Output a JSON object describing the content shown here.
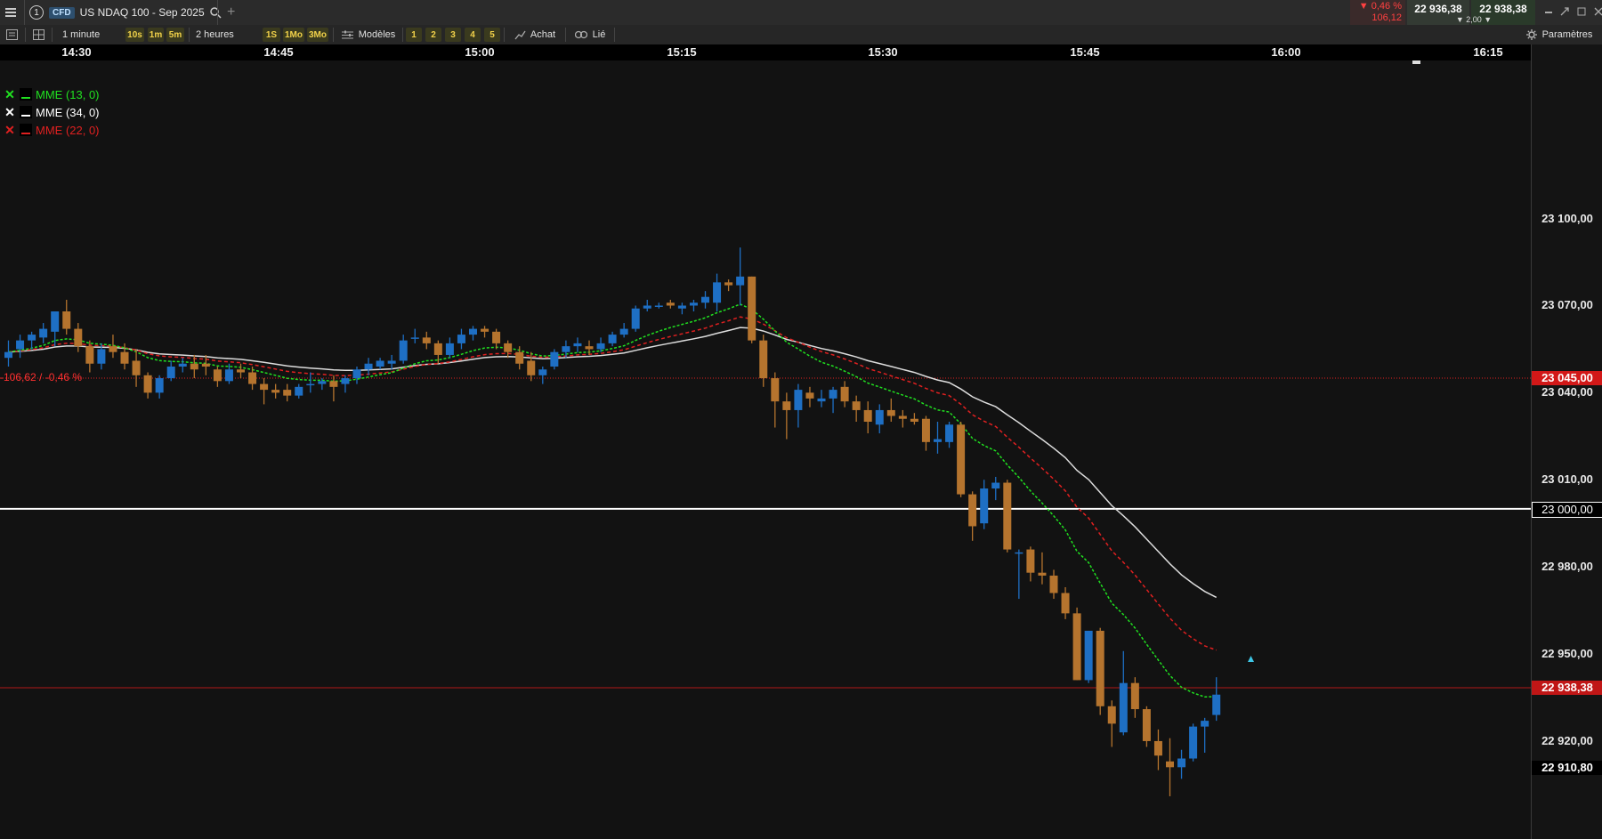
{
  "topbar": {
    "info_label": "1",
    "cfd_badge": "CFD",
    "instrument": "US NDAQ 100 - Sep 2025",
    "add_tab": "+",
    "change_pct": "▼ 0,46 %",
    "change_pts": "106,12",
    "bid": "22 936,38",
    "ask": "22 938,38",
    "spread": "▼ 2,00 ▼"
  },
  "toolbar": {
    "interval": "1 minute",
    "tf_10s": "10s",
    "tf_1m": "1m",
    "tf_5m": "5m",
    "range": "2 heures",
    "range_1s": "1S",
    "range_1mo": "1Mo",
    "range_3mo": "3Mo",
    "templates": "Modèles",
    "layout_1": "1",
    "layout_2": "2",
    "layout_3": "3",
    "layout_4": "4",
    "layout_5": "5",
    "buy": "Achat",
    "linked": "Lié",
    "settings": "Paramètres"
  },
  "time_axis": [
    "14:30",
    "14:45",
    "15:00",
    "15:15",
    "15:30",
    "15:45",
    "16:00",
    "16:15"
  ],
  "legend": [
    {
      "label": "MME (13, 0)",
      "color": "#20e020"
    },
    {
      "label": "MME (34, 0)",
      "color": "#ffffff"
    },
    {
      "label": "MME (22, 0)",
      "color": "#e02020"
    }
  ],
  "prev_close_label": "-106,62 / -0,46 %",
  "price_axis": {
    "ticks": [
      "23 100,00",
      "23 070,00",
      "23 040,00",
      "23 010,00",
      "22 980,00",
      "22 950,00",
      "22 920,00"
    ],
    "prev_close_tag": "23 045,00",
    "level_tag": "23 000,00",
    "current_tag": "22 938,38",
    "low_tag": "22 910,80"
  },
  "colors": {
    "up": "#1e6fc4",
    "down": "#b5742e",
    "ema13": "#20e020",
    "ema34": "#dddddd",
    "ema22": "#e02020",
    "prev_close": "#e02020",
    "level": "#ffffff"
  },
  "chart_data": {
    "type": "candlestick",
    "interval": "1 minute",
    "ylim": [
      22897,
      23125
    ],
    "prev_close": 23045,
    "horizontal_level": 23000,
    "last_price": 22938.38,
    "candles": [
      {
        "o": 23052,
        "h": 23058,
        "l": 23049,
        "c": 23054
      },
      {
        "o": 23055,
        "h": 23060,
        "l": 23052,
        "c": 23058
      },
      {
        "o": 23058,
        "h": 23061,
        "l": 23055,
        "c": 23060
      },
      {
        "o": 23059,
        "h": 23064,
        "l": 23057,
        "c": 23062
      },
      {
        "o": 23061,
        "h": 23066,
        "l": 23056,
        "c": 23068
      },
      {
        "o": 23068,
        "h": 23072,
        "l": 23060,
        "c": 23062
      },
      {
        "o": 23062,
        "h": 23064,
        "l": 23054,
        "c": 23056
      },
      {
        "o": 23056,
        "h": 23058,
        "l": 23047,
        "c": 23050
      },
      {
        "o": 23050,
        "h": 23057,
        "l": 23048,
        "c": 23055
      },
      {
        "o": 23056,
        "h": 23060,
        "l": 23052,
        "c": 23054
      },
      {
        "o": 23054,
        "h": 23057,
        "l": 23048,
        "c": 23050
      },
      {
        "o": 23051,
        "h": 23055,
        "l": 23042,
        "c": 23046
      },
      {
        "o": 23046,
        "h": 23047,
        "l": 23038,
        "c": 23040
      },
      {
        "o": 23040,
        "h": 23046,
        "l": 23038,
        "c": 23045
      },
      {
        "o": 23045,
        "h": 23051,
        "l": 23044,
        "c": 23049
      },
      {
        "o": 23049,
        "h": 23052,
        "l": 23047,
        "c": 23050
      },
      {
        "o": 23050,
        "h": 23053,
        "l": 23045,
        "c": 23048
      },
      {
        "o": 23050,
        "h": 23053,
        "l": 23046,
        "c": 23049
      },
      {
        "o": 23048,
        "h": 23049,
        "l": 23042,
        "c": 23044
      },
      {
        "o": 23044,
        "h": 23050,
        "l": 23043,
        "c": 23048
      },
      {
        "o": 23048,
        "h": 23050,
        "l": 23045,
        "c": 23047
      },
      {
        "o": 23047,
        "h": 23049,
        "l": 23041,
        "c": 23043
      },
      {
        "o": 23043,
        "h": 23045,
        "l": 23036,
        "c": 23041
      },
      {
        "o": 23041,
        "h": 23043,
        "l": 23038,
        "c": 23040
      },
      {
        "o": 23041,
        "h": 23043,
        "l": 23037,
        "c": 23039
      },
      {
        "o": 23039,
        "h": 23043,
        "l": 23038,
        "c": 23042
      },
      {
        "o": 23043,
        "h": 23047,
        "l": 23040,
        "c": 23043
      },
      {
        "o": 23043,
        "h": 23045,
        "l": 23041,
        "c": 23044
      },
      {
        "o": 23044,
        "h": 23046,
        "l": 23037,
        "c": 23042
      },
      {
        "o": 23043,
        "h": 23046,
        "l": 23040,
        "c": 23045
      },
      {
        "o": 23045,
        "h": 23049,
        "l": 23043,
        "c": 23048
      },
      {
        "o": 23048,
        "h": 23052,
        "l": 23046,
        "c": 23050
      },
      {
        "o": 23049,
        "h": 23052,
        "l": 23048,
        "c": 23051
      },
      {
        "o": 23050,
        "h": 23053,
        "l": 23048,
        "c": 23051
      },
      {
        "o": 23051,
        "h": 23060,
        "l": 23050,
        "c": 23058
      },
      {
        "o": 23059,
        "h": 23062,
        "l": 23057,
        "c": 23059
      },
      {
        "o": 23059,
        "h": 23061,
        "l": 23055,
        "c": 23057
      },
      {
        "o": 23057,
        "h": 23058,
        "l": 23050,
        "c": 23053
      },
      {
        "o": 23053,
        "h": 23059,
        "l": 23052,
        "c": 23057
      },
      {
        "o": 23057,
        "h": 23062,
        "l": 23055,
        "c": 23060
      },
      {
        "o": 23060,
        "h": 23063,
        "l": 23058,
        "c": 23062
      },
      {
        "o": 23062,
        "h": 23063,
        "l": 23059,
        "c": 23061
      },
      {
        "o": 23061,
        "h": 23062,
        "l": 23055,
        "c": 23057
      },
      {
        "o": 23057,
        "h": 23058,
        "l": 23052,
        "c": 23054
      },
      {
        "o": 23054,
        "h": 23056,
        "l": 23048,
        "c": 23050
      },
      {
        "o": 23051,
        "h": 23054,
        "l": 23044,
        "c": 23046
      },
      {
        "o": 23046,
        "h": 23049,
        "l": 23043,
        "c": 23048
      },
      {
        "o": 23049,
        "h": 23055,
        "l": 23048,
        "c": 23054
      },
      {
        "o": 23054,
        "h": 23058,
        "l": 23052,
        "c": 23056
      },
      {
        "o": 23056,
        "h": 23059,
        "l": 23054,
        "c": 23057
      },
      {
        "o": 23056,
        "h": 23058,
        "l": 23053,
        "c": 23055
      },
      {
        "o": 23055,
        "h": 23059,
        "l": 23054,
        "c": 23057
      },
      {
        "o": 23057,
        "h": 23061,
        "l": 23056,
        "c": 23060
      },
      {
        "o": 23060,
        "h": 23064,
        "l": 23059,
        "c": 23062
      },
      {
        "o": 23062,
        "h": 23070,
        "l": 23061,
        "c": 23069
      },
      {
        "o": 23069,
        "h": 23072,
        "l": 23068,
        "c": 23070
      },
      {
        "o": 23070,
        "h": 23071,
        "l": 23069,
        "c": 23070
      },
      {
        "o": 23071,
        "h": 23072,
        "l": 23069,
        "c": 23070
      },
      {
        "o": 23069,
        "h": 23071,
        "l": 23067,
        "c": 23070
      },
      {
        "o": 23070,
        "h": 23072,
        "l": 23068,
        "c": 23071
      },
      {
        "o": 23071,
        "h": 23075,
        "l": 23069,
        "c": 23073
      },
      {
        "o": 23071,
        "h": 23081,
        "l": 23068,
        "c": 23078
      },
      {
        "o": 23078,
        "h": 23079,
        "l": 23075,
        "c": 23077
      },
      {
        "o": 23077,
        "h": 23090,
        "l": 23070,
        "c": 23080
      },
      {
        "o": 23080,
        "h": 23080,
        "l": 23057,
        "c": 23058
      },
      {
        "o": 23058,
        "h": 23060,
        "l": 23042,
        "c": 23045
      },
      {
        "o": 23045,
        "h": 23047,
        "l": 23028,
        "c": 23037
      },
      {
        "o": 23037,
        "h": 23040,
        "l": 23024,
        "c": 23034
      },
      {
        "o": 23034,
        "h": 23043,
        "l": 23028,
        "c": 23041
      },
      {
        "o": 23040,
        "h": 23042,
        "l": 23035,
        "c": 23038
      },
      {
        "o": 23037,
        "h": 23041,
        "l": 23035,
        "c": 23038
      },
      {
        "o": 23038,
        "h": 23042,
        "l": 23033,
        "c": 23041
      },
      {
        "o": 23042,
        "h": 23044,
        "l": 23035,
        "c": 23037
      },
      {
        "o": 23037,
        "h": 23039,
        "l": 23030,
        "c": 23034
      },
      {
        "o": 23034,
        "h": 23037,
        "l": 23026,
        "c": 23030
      },
      {
        "o": 23029,
        "h": 23036,
        "l": 23026,
        "c": 23034
      },
      {
        "o": 23034,
        "h": 23038,
        "l": 23030,
        "c": 23032
      },
      {
        "o": 23032,
        "h": 23034,
        "l": 23028,
        "c": 23031
      },
      {
        "o": 23031,
        "h": 23033,
        "l": 23029,
        "c": 23030
      },
      {
        "o": 23031,
        "h": 23032,
        "l": 23020,
        "c": 23023
      },
      {
        "o": 23023,
        "h": 23030,
        "l": 23019,
        "c": 23024
      },
      {
        "o": 23023,
        "h": 23030,
        "l": 23021,
        "c": 23029
      },
      {
        "o": 23029,
        "h": 23030,
        "l": 23004,
        "c": 23005
      },
      {
        "o": 23005,
        "h": 23006,
        "l": 22989,
        "c": 22994
      },
      {
        "o": 22995,
        "h": 23010,
        "l": 22993,
        "c": 23007
      },
      {
        "o": 23007,
        "h": 23011,
        "l": 23003,
        "c": 23009
      },
      {
        "o": 23009,
        "h": 23010,
        "l": 22985,
        "c": 22986
      },
      {
        "o": 22985,
        "h": 22986,
        "l": 22969,
        "c": 22985
      },
      {
        "o": 22986,
        "h": 22987,
        "l": 22975,
        "c": 22978
      },
      {
        "o": 22978,
        "h": 22985,
        "l": 22974,
        "c": 22977
      },
      {
        "o": 22977,
        "h": 22979,
        "l": 22969,
        "c": 22971
      },
      {
        "o": 22971,
        "h": 22973,
        "l": 22962,
        "c": 22964
      },
      {
        "o": 22964,
        "h": 22966,
        "l": 22941,
        "c": 22941
      },
      {
        "o": 22941,
        "h": 22958,
        "l": 22940,
        "c": 22958
      },
      {
        "o": 22958,
        "h": 22959,
        "l": 22929,
        "c": 22932
      },
      {
        "o": 22932,
        "h": 22934,
        "l": 22918,
        "c": 22926
      },
      {
        "o": 22923,
        "h": 22951,
        "l": 22922,
        "c": 22940
      },
      {
        "o": 22940,
        "h": 22942,
        "l": 22928,
        "c": 22931
      },
      {
        "o": 22931,
        "h": 22932,
        "l": 22918,
        "c": 22920
      },
      {
        "o": 22920,
        "h": 22924,
        "l": 22910,
        "c": 22915
      },
      {
        "o": 22913,
        "h": 22921,
        "l": 22901,
        "c": 22911
      },
      {
        "o": 22911,
        "h": 22917,
        "l": 22907,
        "c": 22914
      },
      {
        "o": 22914,
        "h": 22926,
        "l": 22913,
        "c": 22925
      },
      {
        "o": 22925,
        "h": 22928,
        "l": 22916,
        "c": 22927
      },
      {
        "o": 22929,
        "h": 22942,
        "l": 22927,
        "c": 22936
      }
    ]
  }
}
